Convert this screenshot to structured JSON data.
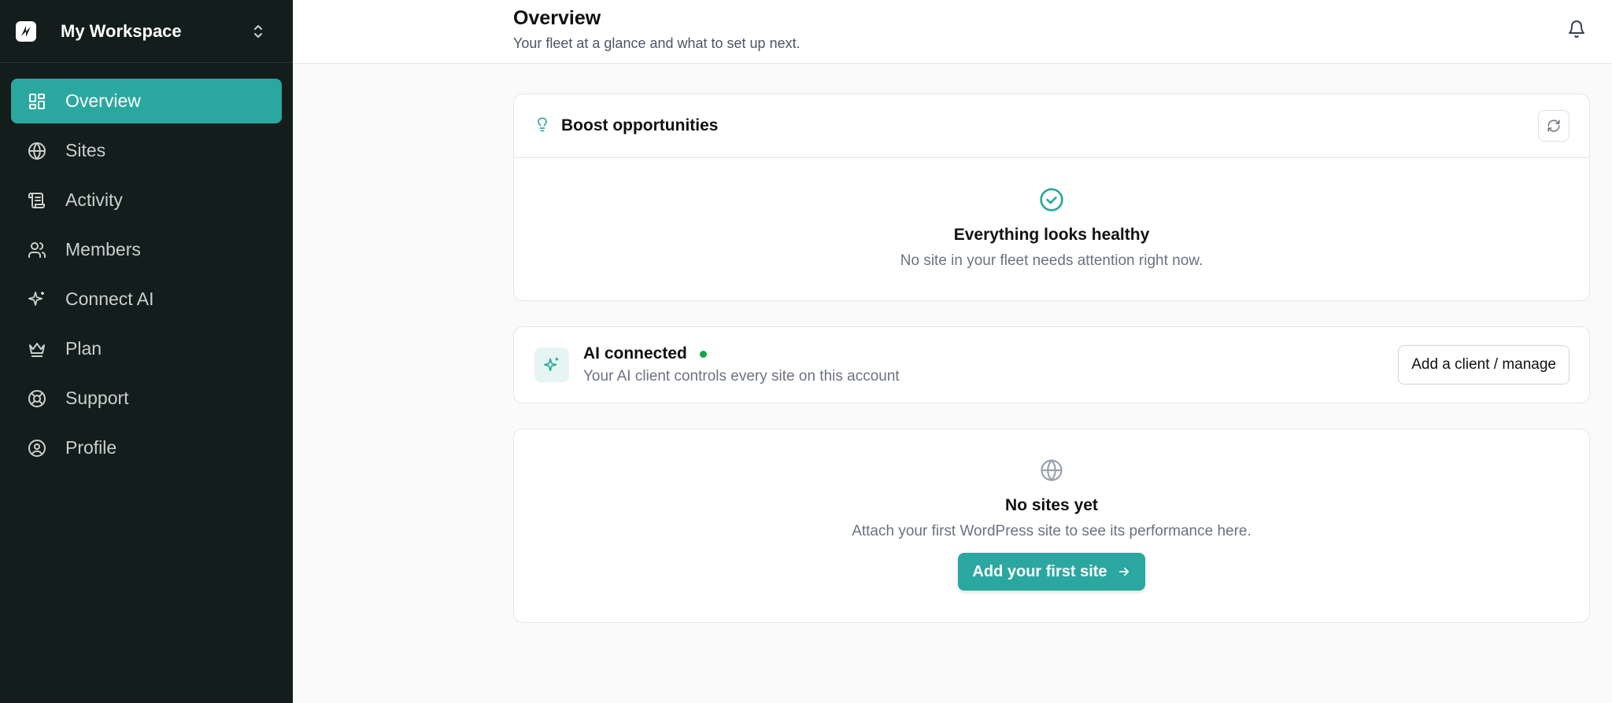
{
  "workspace": {
    "name": "My Workspace"
  },
  "sidebar": {
    "items": [
      {
        "label": "Overview",
        "icon": "layout-grid-icon",
        "active": true
      },
      {
        "label": "Sites",
        "icon": "globe-icon"
      },
      {
        "label": "Activity",
        "icon": "scroll-icon"
      },
      {
        "label": "Members",
        "icon": "users-icon"
      },
      {
        "label": "Connect AI",
        "icon": "sparkles-icon"
      },
      {
        "label": "Plan",
        "icon": "crown-icon"
      },
      {
        "label": "Support",
        "icon": "life-buoy-icon"
      },
      {
        "label": "Profile",
        "icon": "user-circle-icon"
      }
    ]
  },
  "header": {
    "title": "Overview",
    "subtitle": "Your fleet at a glance and what to set up next."
  },
  "boost": {
    "title": "Boost opportunities",
    "empty_title": "Everything looks healthy",
    "empty_sub": "No site in your fleet needs attention right now."
  },
  "ai": {
    "title": "AI connected",
    "subtitle": "Your AI client controls every site on this account",
    "button": "Add a client / manage",
    "status_color": "#16a34a"
  },
  "sites": {
    "empty_title": "No sites yet",
    "empty_sub": "Attach your first WordPress site to see its performance here.",
    "button": "Add your first site"
  },
  "colors": {
    "accent": "#2aa89f",
    "sidebar_bg": "#131d1c"
  }
}
